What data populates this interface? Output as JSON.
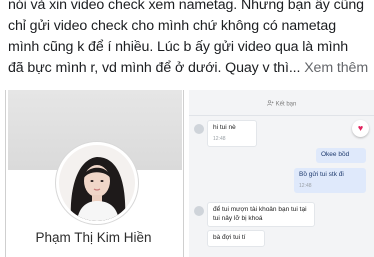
{
  "post": {
    "lines": [
      "nói và xin video check xem nametag. Nhưng bạn ấy cũng",
      "chỉ gửi video check cho mình chứ không có nametag",
      "mình cũng k để í nhiều. Lúc b ấy gửi video qua là mình",
      "đã bực mình r, vd mình để ở dưới. Quay v thì..."
    ],
    "see_more": "Xem thêm"
  },
  "profile": {
    "name": "Phạm Thị Kim Hiền"
  },
  "chat": {
    "add_friend": "Kết bạn",
    "messages": [
      {
        "dir": "in",
        "text": "hi tui nè",
        "time": "12:48"
      },
      {
        "dir": "out",
        "text": "Okee bồd",
        "time": ""
      },
      {
        "dir": "out",
        "text": "Bồ gửi tui stk đi",
        "time": "12:48"
      },
      {
        "dir": "in",
        "text": "để tui mượn tài khoản bạn tui tại tui nảy lỡ bị khoá",
        "time": ""
      },
      {
        "dir": "in",
        "text": "bà đợi tui tí",
        "time": ""
      }
    ]
  },
  "colors": {
    "text": "#1c1e21",
    "see_more": "#65676b",
    "out_bubble": "#dfe9fb",
    "heart": "#e0245e"
  },
  "icons": {
    "add_friend": "person-plus-icon",
    "heart": "heart-icon"
  }
}
